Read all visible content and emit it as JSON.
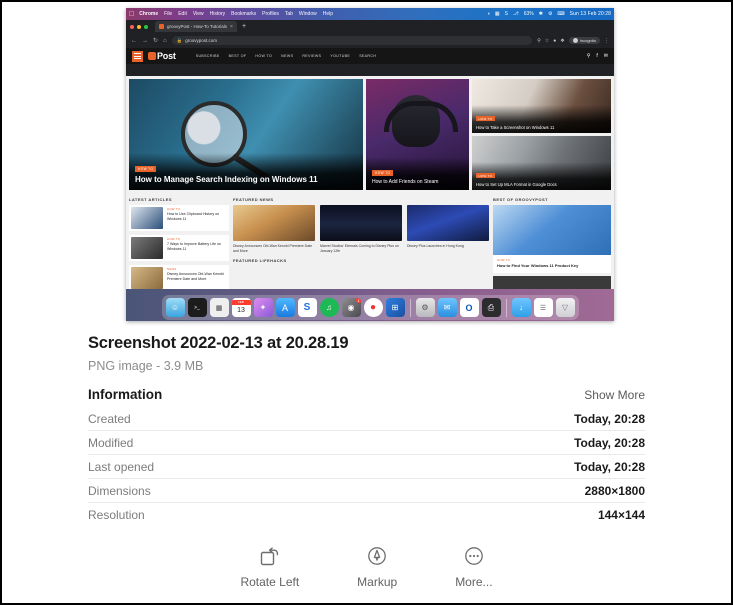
{
  "file": {
    "name": "Screenshot 2022-02-13 at 20.28.19",
    "meta": "PNG image - 3.9 MB"
  },
  "information": {
    "heading": "Information",
    "show_more": "Show More",
    "rows": [
      {
        "key": "Created",
        "value": "Today, 20:28"
      },
      {
        "key": "Modified",
        "value": "Today, 20:28"
      },
      {
        "key": "Last opened",
        "value": "Today, 20:28"
      },
      {
        "key": "Dimensions",
        "value": "2880×1800"
      },
      {
        "key": "Resolution",
        "value": "144×144"
      }
    ]
  },
  "actions": [
    {
      "icon": "rotate-left-icon",
      "label": "Rotate Left"
    },
    {
      "icon": "markup-icon",
      "label": "Markup"
    },
    {
      "icon": "more-icon",
      "label": "More..."
    }
  ],
  "preview": {
    "menubar": {
      "apple": "",
      "items": [
        "Chrome",
        "File",
        "Edit",
        "View",
        "History",
        "Bookmarks",
        "Profiles",
        "Tab",
        "Window",
        "Help"
      ],
      "status": [
        "◑",
        "▦",
        "S",
        "⎇",
        "✱",
        "⚙",
        "⌨"
      ],
      "battery": "63%",
      "clock": "Sun 13 Feb  20:28"
    },
    "browser": {
      "tab_title": "groovyPost - How-To Tutorials",
      "tab_close": "×",
      "new_tab": "+",
      "url": "groovypost.com",
      "profile": "Incognito",
      "nav": {
        "back": "←",
        "forward": "→",
        "reload": "↻",
        "home": "⌂"
      }
    },
    "site": {
      "brand": "Post",
      "nav": [
        "SUBSCRIBE",
        "BEST OF",
        "HOW TO",
        "NEWS",
        "REVIEWS",
        "YOUTUBE",
        "SEARCH"
      ],
      "hero_main": {
        "badge": "HOW TO",
        "title": "How to Manage Search Indexing on Windows 11"
      },
      "hero_mid": {
        "badge": "HOW TO",
        "title": "How to Add Friends on Steam"
      },
      "hero_right": [
        {
          "badge": "HOW TO",
          "title": "How to Take a Screenshot on Windows 11"
        },
        {
          "badge": "HOW TO",
          "title": "How to Set Up MLA Format in Google Docs"
        }
      ],
      "sections": {
        "latest": "LATEST ARTICLES",
        "news": "FEATURED NEWS",
        "best": "BEST OF GROOVYPOST",
        "lifehacks": "FEATURED LIFEHACKS"
      },
      "latest_articles": [
        {
          "kicker": "HOW TO",
          "title": "How to Use Clipboard History on Windows 11"
        },
        {
          "kicker": "HOW TO",
          "title": "7 Ways to Improve Battery Life on Windows 11"
        },
        {
          "kicker": "NEWS",
          "title": "Disney Announces Obi-Wan Kenobi Premiere Date and More"
        }
      ],
      "featured_news": [
        {
          "title": "Disney Announces Obi-Wan Kenobi Premiere Date and More"
        },
        {
          "title": "Marvel Studios' Eternals Coming to Disney Plus on January 12th"
        },
        {
          "title": "Disney Plus Launches in Hong Kong"
        }
      ],
      "best_card": {
        "kicker": "HOW TO",
        "title": "How to Find Your Windows 11 Product Key"
      }
    },
    "dock": [
      {
        "name": "finder",
        "glyph": "☺"
      },
      {
        "name": "terminal",
        "glyph": ">_"
      },
      {
        "name": "launchpad",
        "glyph": "▦"
      },
      {
        "name": "calendar",
        "glyph": "13"
      },
      {
        "name": "affinity",
        "glyph": "✦"
      },
      {
        "name": "app-store",
        "glyph": "A"
      },
      {
        "name": "setapp",
        "glyph": "S"
      },
      {
        "name": "spotify",
        "glyph": "♫"
      },
      {
        "name": "podcasts",
        "glyph": "◉"
      },
      {
        "name": "chrome",
        "glyph": "●"
      },
      {
        "name": "windows-app",
        "glyph": "⊞"
      },
      {
        "name": "system-preferences",
        "glyph": "⚙"
      },
      {
        "name": "mail",
        "glyph": "✉"
      },
      {
        "name": "outlook",
        "glyph": "O"
      },
      {
        "name": "printer",
        "glyph": "⎙"
      },
      {
        "name": "downloads-folder",
        "glyph": "↓"
      },
      {
        "name": "documents-stack",
        "glyph": "☰"
      },
      {
        "name": "trash",
        "glyph": "▽"
      }
    ],
    "calendar_month": "FEB"
  }
}
